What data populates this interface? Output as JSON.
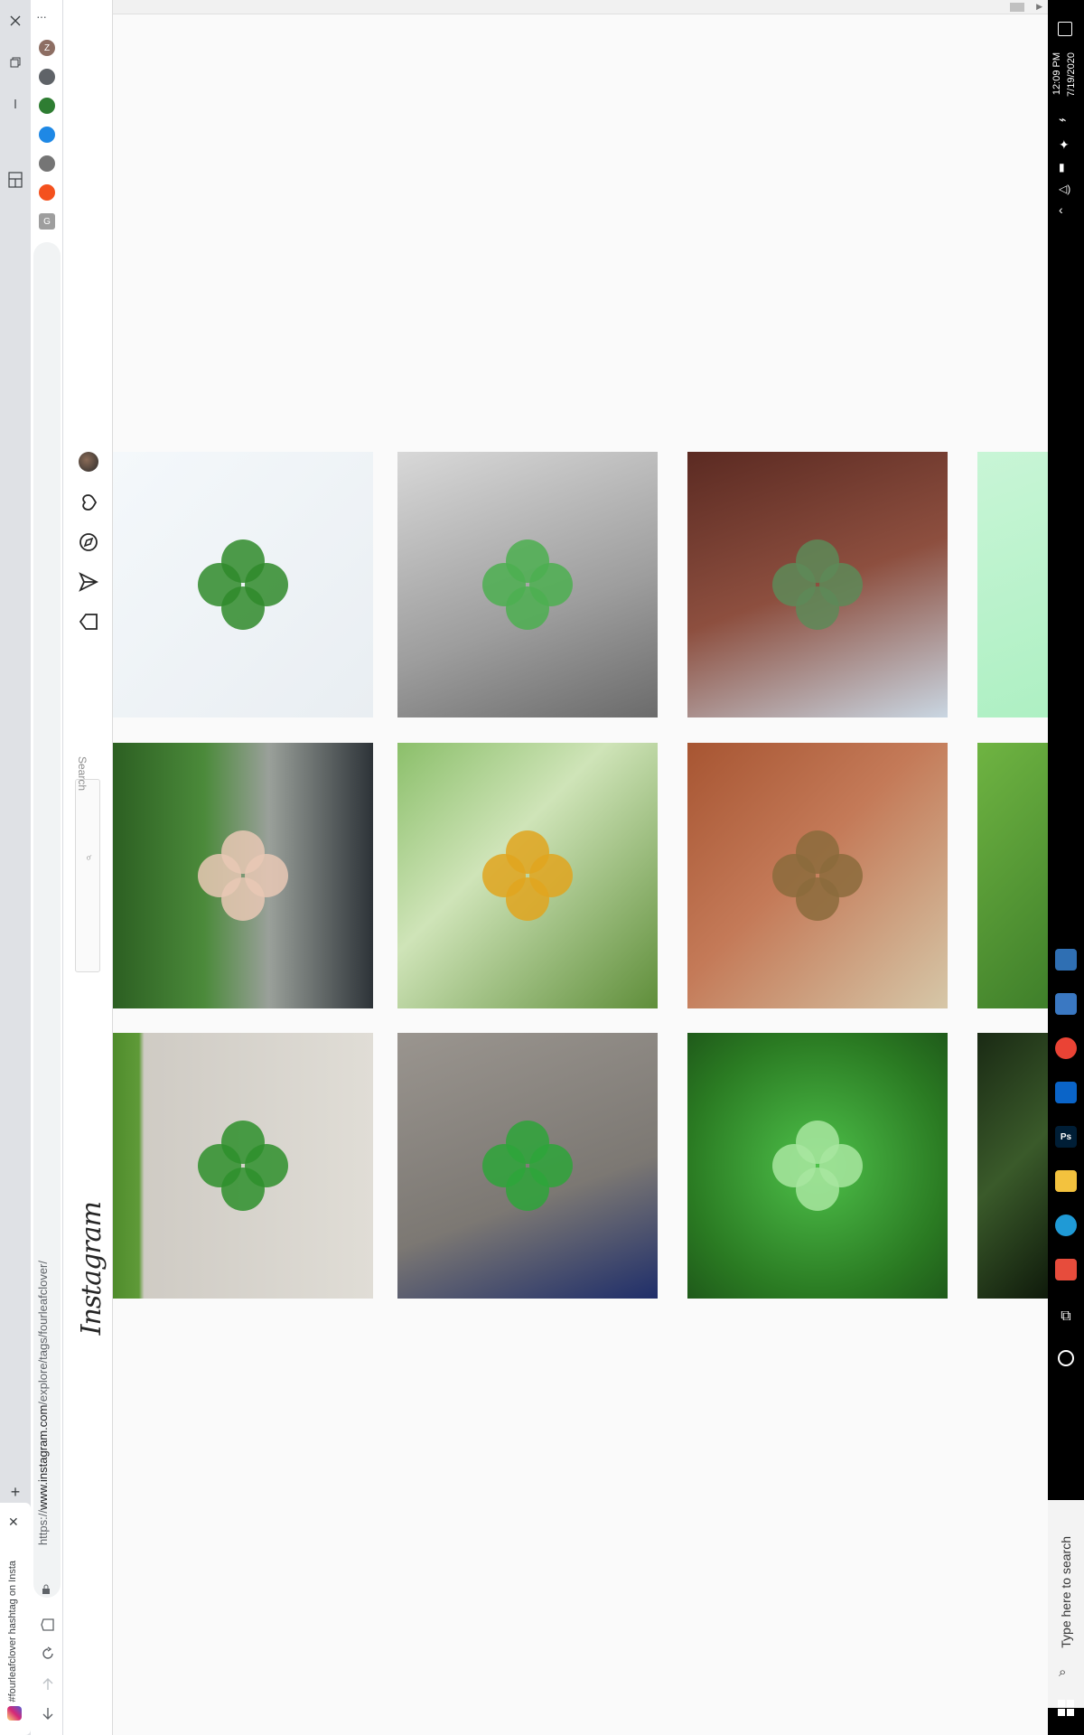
{
  "browser": {
    "tab_title": "#fourleafclover hashtag on Insta",
    "url_prefix": "https://",
    "url_host": "www.instagram.com",
    "url_path": "/explore/tags/fourleafclover/",
    "new_tab_label": "+",
    "menu_label": "···",
    "extensions": [
      {
        "name": "profile-avatar",
        "label": "Z",
        "color": "#8d6e63"
      },
      {
        "name": "puzzle-extension",
        "label": "",
        "color": "#5f6368"
      },
      {
        "name": "map-extension",
        "label": "",
        "color": "#2e7d32"
      },
      {
        "name": "info-extension",
        "label": "",
        "color": "#1e88e5"
      },
      {
        "name": "circle-extension",
        "label": "",
        "color": "#757575"
      },
      {
        "name": "orange-extension",
        "label": "",
        "color": "#f4511e"
      },
      {
        "name": "g-extension",
        "label": "G",
        "color": "#9e9e9e"
      }
    ]
  },
  "instagram": {
    "logo": "Instagram",
    "search_placeholder": "Search",
    "nav_icons": [
      "home-icon",
      "direct-message-icon",
      "explore-icon",
      "activity-heart-icon",
      "profile-avatar"
    ]
  },
  "grid": {
    "tiles": [
      {
        "name": "post-clover-two-stems",
        "row": 0,
        "col": 0,
        "bg": "linear-gradient(135deg,#f4f8fb,#e9eef2)",
        "accent": "#2f8a2a"
      },
      {
        "name": "post-husky-clover",
        "row": 0,
        "col": 1,
        "bg": "linear-gradient(160deg,#d8d8d8,#9d9d9d 60%,#6b6b6b)",
        "accent": "#4caf50"
      },
      {
        "name": "post-clover-planter",
        "row": 0,
        "col": 2,
        "bg": "linear-gradient(160deg,#5b2a22,#8d4f3f 50%,#c9d6e2)",
        "accent": "#5d8a58"
      },
      {
        "name": "post-illustration",
        "row": 0,
        "col": 3,
        "bg": "linear-gradient(160deg,#c8f5d6,#aef0c3)",
        "accent": "#1e8bc3"
      },
      {
        "name": "post-hand-clover-road",
        "row": 1,
        "col": 0,
        "bg": "linear-gradient(90deg,#2c5f22,#4b8a3a 35%,#9aa09a 60%,#2d3338)",
        "accent": "#e9c8b5"
      },
      {
        "name": "post-woman-yellow-dress",
        "row": 1,
        "col": 1,
        "bg": "linear-gradient(135deg,#8bbf6a,#cfe4b8 40%,#5f8e3a)",
        "accent": "#e0a51f"
      },
      {
        "name": "post-woman-portrait",
        "row": 1,
        "col": 2,
        "bg": "linear-gradient(135deg,#a75532,#c47a58 45%,#d6c7a8)",
        "accent": "#8b6b3c"
      },
      {
        "name": "post-grass-partial",
        "row": 1,
        "col": 3,
        "bg": "linear-gradient(135deg,#6fb442,#3f7f2a)",
        "accent": "#8a6a4a"
      },
      {
        "name": "post-clover-sidewalk",
        "row": 2,
        "col": 0,
        "bg": "linear-gradient(90deg,#4f8c2c 0%,#5f9a38 10%,#cfcbc4 12%,#e0ddd6 100%)",
        "accent": "#2e8f2c"
      },
      {
        "name": "post-child-hand-clover",
        "row": 2,
        "col": 1,
        "bg": "linear-gradient(160deg,#9a958f,#7c7873 60%,#1f2e6a)",
        "accent": "#2ea43a"
      },
      {
        "name": "post-clover-patch",
        "row": 2,
        "col": 2,
        "bg": "radial-gradient(circle at 50% 50%,#4ec14a,#2a7a22 70%,#1f5a1a)",
        "accent": "#a8e6a0"
      },
      {
        "name": "post-dark-trees",
        "row": 2,
        "col": 3,
        "bg": "linear-gradient(135deg,#1a2a14,#3a5a2a 50%,#0f1a0b)",
        "accent": "#c8d0c0"
      }
    ]
  },
  "taskbar": {
    "time": "12:09 PM",
    "date": "7/19/2020",
    "search_placeholder": "Type here to search",
    "apps": [
      {
        "name": "store-app",
        "label": "",
        "color": "#2f6fb3"
      },
      {
        "name": "settings-app",
        "label": "",
        "color": "#3a78c2"
      },
      {
        "name": "chrome-app",
        "label": "",
        "color": "#ea4335"
      },
      {
        "name": "outlook-app",
        "label": "",
        "color": "#0a64c8"
      },
      {
        "name": "photoshop-app",
        "label": "Ps",
        "color": "#001e36"
      },
      {
        "name": "explorer-app",
        "label": "",
        "color": "#f3c23e"
      },
      {
        "name": "edge-app",
        "label": "",
        "color": "#1f9ad6"
      },
      {
        "name": "office-app",
        "label": "",
        "color": "#e74c3c"
      }
    ]
  }
}
